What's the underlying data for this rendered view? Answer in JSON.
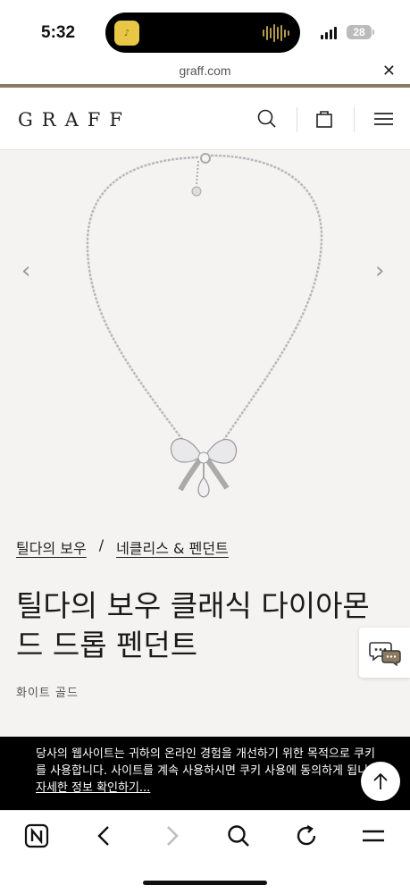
{
  "status": {
    "time": "5:32",
    "battery": "28"
  },
  "browser": {
    "url": "graff.com"
  },
  "header": {
    "logo": "GRAFF"
  },
  "breadcrumb": {
    "collection": "틸다의 보우",
    "separator": "/",
    "category": "네클리스 & 펜던트"
  },
  "product": {
    "title_line1": "틸다의 보우 클래식 다이아몬",
    "title_line2": "드 드롭 펜던트",
    "material": "화이트 골드"
  },
  "cookie": {
    "line1": "당사의 웹사이트는 귀하의 온라인 경험을 개선하기 위한 목적으로 쿠키",
    "line2": "를 사용합니다. 사이트를 계속 사용하시면 쿠키 사용에 동의하게 됩니다.",
    "link": "자세한 정보 확인하기..."
  },
  "colors": {
    "accent_gold": "#8b7a5e",
    "hero_bg": "#f5f3f2",
    "cookie_bg": "#000000"
  },
  "icons": {
    "header": [
      "search-icon",
      "bag-icon",
      "menu-icon"
    ],
    "bottom": [
      "naver-icon",
      "back-icon",
      "forward-icon",
      "search-icon",
      "reload-icon",
      "menu-icon"
    ]
  }
}
